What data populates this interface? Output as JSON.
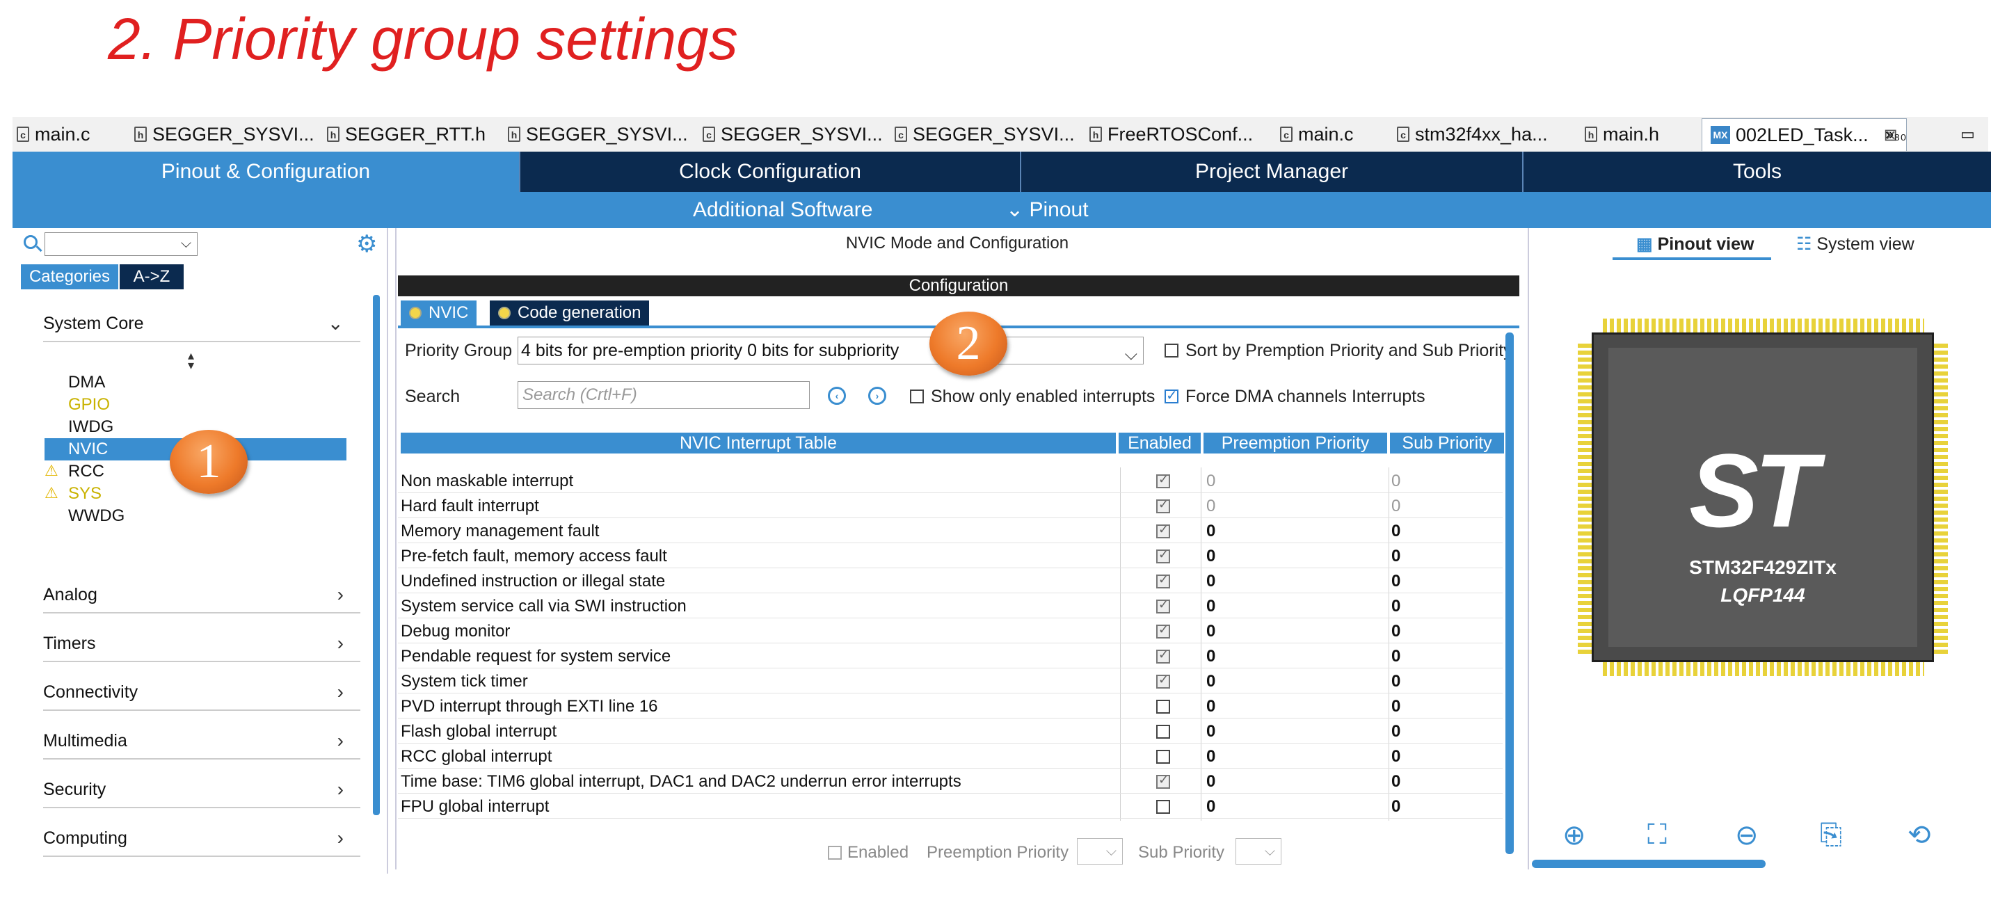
{
  "slide": {
    "title": "2. Priority group settings"
  },
  "editor_tabs": [
    {
      "label": "main.c",
      "icon": "file-c-icon"
    },
    {
      "label": "SEGGER_SYSVI...",
      "icon": "file-h-icon"
    },
    {
      "label": "SEGGER_RTT.h",
      "icon": "file-h-icon"
    },
    {
      "label": "SEGGER_SYSVI...",
      "icon": "file-h-icon"
    },
    {
      "label": "SEGGER_SYSVI...",
      "icon": "file-c-icon"
    },
    {
      "label": "SEGGER_SYSVI...",
      "icon": "file-c-icon"
    },
    {
      "label": "FreeRTOSConf...",
      "icon": "file-h-icon"
    },
    {
      "label": "main.c",
      "icon": "file-c-icon"
    },
    {
      "label": "stm32f4xx_ha...",
      "icon": "file-c-icon"
    },
    {
      "label": "main.h",
      "icon": "file-h-icon"
    },
    {
      "label": "002LED_Task...",
      "icon": "mx-file-icon",
      "active": true
    }
  ],
  "editor_icons": {
    "mx_glyph": "MX",
    "c_glyph": "c",
    "h_glyph": "h",
    "close": "⊠",
    "overflow": "»₈₀",
    "minimize": "▭"
  },
  "main_tabs": [
    "Pinout & Configuration",
    "Clock Configuration",
    "Project Manager",
    "Tools"
  ],
  "sub_links": {
    "additional_software": "Additional Software",
    "pinout": "Pinout",
    "pinout_chevron": "⌄"
  },
  "left_panel": {
    "categories_btn": "Categories",
    "az_btn": "A->Z",
    "system_core": "System Core",
    "core_items": [
      {
        "label": "DMA",
        "style": "normal"
      },
      {
        "label": "GPIO",
        "style": "yellow"
      },
      {
        "label": "IWDG",
        "style": "normal"
      },
      {
        "label": "NVIC",
        "style": "selected"
      },
      {
        "label": "RCC",
        "style": "warning"
      },
      {
        "label": "SYS",
        "style": "warning-yellow"
      },
      {
        "label": "WWDG",
        "style": "normal"
      }
    ],
    "sections": [
      "Analog",
      "Timers",
      "Connectivity",
      "Multimedia",
      "Security",
      "Computing"
    ]
  },
  "callouts": {
    "one": "1",
    "two": "2"
  },
  "center": {
    "title": "NVIC Mode and Configuration",
    "config_bar": "Configuration",
    "subtabs": [
      "NVIC",
      "Code generation"
    ],
    "priority_group_label": "Priority Group",
    "priority_group_value": "4 bits for pre-emption priority 0 bits for subpriority",
    "sort_label": "Sort by Premption Priority and Sub Priority",
    "search_label": "Search",
    "search_placeholder": "Search (Crtl+F)",
    "show_enabled_label": "Show only enabled interrupts",
    "force_dma_label": "Force DMA channels Interrupts",
    "table_headers": [
      "NVIC Interrupt Table",
      "Enabled",
      "Preemption Priority",
      "Sub Priority"
    ],
    "rows": [
      {
        "name": "Non maskable interrupt",
        "enabled": "locked",
        "pre": "0",
        "sub": "0",
        "dim": true
      },
      {
        "name": "Hard fault interrupt",
        "enabled": "locked",
        "pre": "0",
        "sub": "0",
        "dim": true
      },
      {
        "name": "Memory management fault",
        "enabled": "locked",
        "pre": "0",
        "sub": "0",
        "dim": false
      },
      {
        "name": "Pre-fetch fault, memory access fault",
        "enabled": "locked",
        "pre": "0",
        "sub": "0",
        "dim": false
      },
      {
        "name": "Undefined instruction or illegal state",
        "enabled": "locked",
        "pre": "0",
        "sub": "0",
        "dim": false
      },
      {
        "name": "System service call via SWI instruction",
        "enabled": "locked",
        "pre": "0",
        "sub": "0",
        "dim": false
      },
      {
        "name": "Debug monitor",
        "enabled": "locked",
        "pre": "0",
        "sub": "0",
        "dim": false
      },
      {
        "name": "Pendable request for system service",
        "enabled": "locked",
        "pre": "0",
        "sub": "0",
        "dim": false
      },
      {
        "name": "System tick timer",
        "enabled": "locked",
        "pre": "0",
        "sub": "0",
        "dim": false
      },
      {
        "name": "PVD interrupt through EXTI line 16",
        "enabled": "off",
        "pre": "0",
        "sub": "0",
        "dim": false
      },
      {
        "name": "Flash global interrupt",
        "enabled": "off",
        "pre": "0",
        "sub": "0",
        "dim": false
      },
      {
        "name": "RCC global interrupt",
        "enabled": "off",
        "pre": "0",
        "sub": "0",
        "dim": false
      },
      {
        "name": "Time base: TIM6 global interrupt, DAC1 and DAC2 underrun error interrupts",
        "enabled": "locked",
        "pre": "0",
        "sub": "0",
        "dim": false
      },
      {
        "name": "FPU global interrupt",
        "enabled": "off",
        "pre": "0",
        "sub": "0",
        "dim": false
      }
    ],
    "footer": {
      "enabled": "Enabled",
      "preemption": "Preemption Priority",
      "sub": "Sub Priority"
    }
  },
  "right_panel": {
    "pinout_view": "Pinout view",
    "system_view": "System view",
    "chip_logo": "ST",
    "chip_name": "STM32F429ZITx",
    "chip_package": "LQFP144",
    "tools": [
      "zoom-in-icon",
      "fit-icon",
      "zoom-out-icon",
      "export-icon",
      "rotate-icon"
    ],
    "tool_glyphs": [
      "⊕",
      "⛶",
      "⊖",
      "⎘",
      "⟲"
    ]
  }
}
